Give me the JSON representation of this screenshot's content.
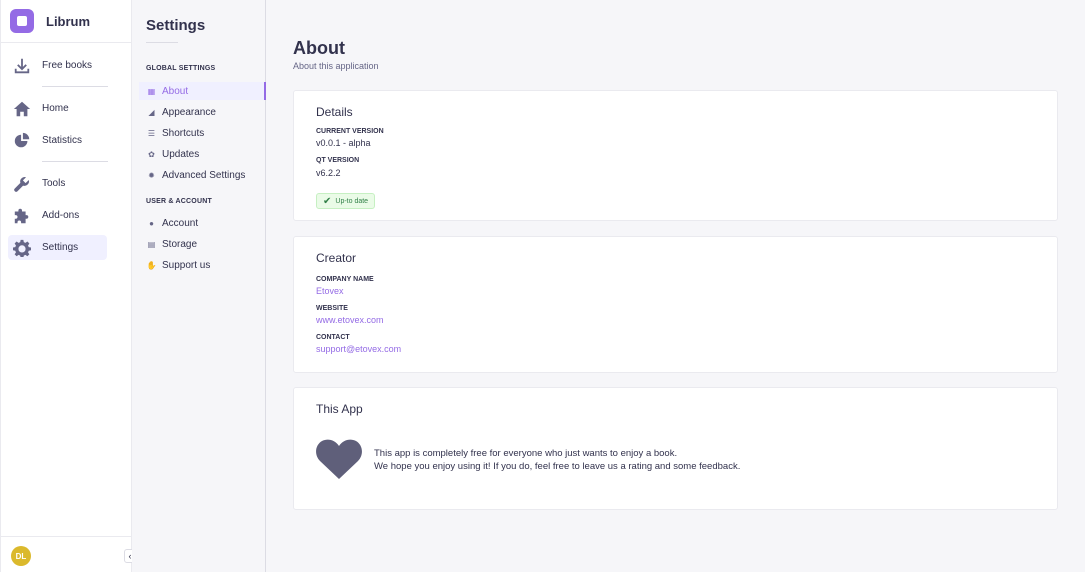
{
  "nav": {
    "app_name": "Librum",
    "items": [
      {
        "label": "Free books",
        "icon": "download-icon"
      },
      {
        "label": "Home",
        "icon": "home-icon"
      },
      {
        "label": "Statistics",
        "icon": "pie-chart-icon"
      },
      {
        "label": "Tools",
        "icon": "wrench-icon"
      },
      {
        "label": "Add-ons",
        "icon": "puzzle-icon"
      },
      {
        "label": "Settings",
        "icon": "gear-icon"
      }
    ],
    "avatar_initials": "DL",
    "collapse_glyph": "‹"
  },
  "settings": {
    "title": "Settings",
    "global_section": "GLOBAL SETTINGS",
    "global_items": [
      {
        "label": "About",
        "icon": "grid-icon"
      },
      {
        "label": "Appearance",
        "icon": "brush-icon"
      },
      {
        "label": "Shortcuts",
        "icon": "sliders-icon"
      },
      {
        "label": "Updates",
        "icon": "refresh-icon"
      },
      {
        "label": "Advanced Settings",
        "icon": "gear-icon"
      }
    ],
    "account_section": "USER & ACCOUNT",
    "account_items": [
      {
        "label": "Account",
        "icon": "user-icon"
      },
      {
        "label": "Storage",
        "icon": "storage-icon"
      },
      {
        "label": "Support us",
        "icon": "hand-icon"
      }
    ]
  },
  "about": {
    "title": "About",
    "subtitle": "About this application",
    "details": {
      "title": "Details",
      "version_label": "CURRENT VERSION",
      "version_value": "v0.0.1 - alpha",
      "qt_label": "QT VERSION",
      "qt_value": "v6.2.2",
      "status": "Up-to date"
    },
    "creator": {
      "title": "Creator",
      "company_label": "COMPANY NAME",
      "company_value": "Etovex",
      "website_label": "WEBSITE",
      "website_value": "www.etovex.com",
      "contact_label": "CONTACT",
      "contact_value": "support@etovex.com"
    },
    "this_app": {
      "title": "This App",
      "line1": "This app is completely free for everyone who just wants to enjoy a book.",
      "line2": "We hope you enjoy using it! If you do, feel free to leave us a rating and some feedback."
    }
  },
  "colors": {
    "accent": "#946be5",
    "success": "#328048",
    "avatar": "#dbb92c"
  }
}
